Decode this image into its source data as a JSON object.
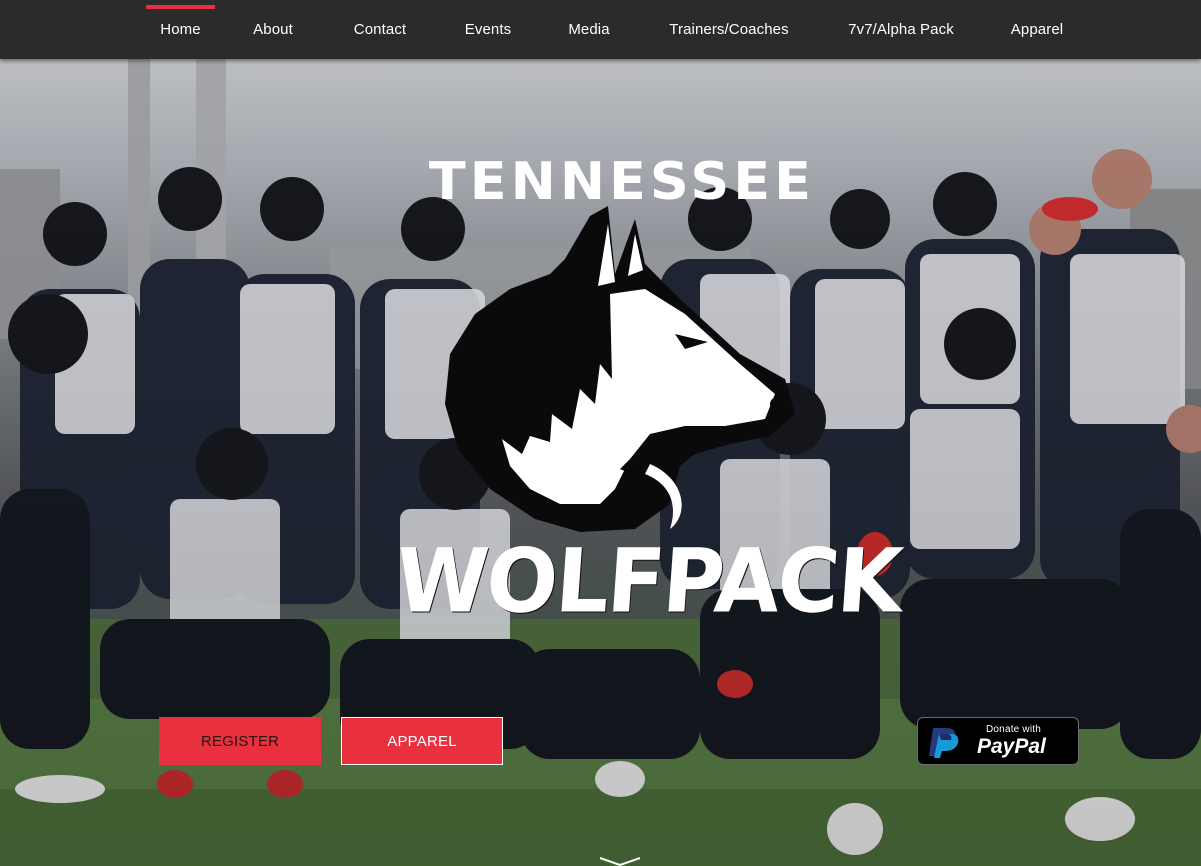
{
  "nav": {
    "items": [
      {
        "label": "Home",
        "active": true
      },
      {
        "label": "About"
      },
      {
        "label": "Contact"
      },
      {
        "label": "Events"
      },
      {
        "label": "Media"
      },
      {
        "label": "Trainers/Coaches"
      },
      {
        "label": "7v7/Alpha Pack"
      },
      {
        "label": "Apparel"
      }
    ]
  },
  "hero": {
    "logo": {
      "top_text": "TENNESSEE",
      "bottom_text": "WOLFPACK",
      "icon": "wolf-head-icon"
    },
    "buttons": {
      "register": "REGISTER",
      "apparel": "APPAREL"
    },
    "paypal": {
      "donate_text": "Donate with",
      "brand_text": "PayPal"
    },
    "scroll_icon": "chevron-down-icon"
  },
  "colors": {
    "nav_bg": "#2b2b2b",
    "accent_red": "#e8303e",
    "text_white": "#ffffff",
    "paypal_bg": "#000000"
  }
}
